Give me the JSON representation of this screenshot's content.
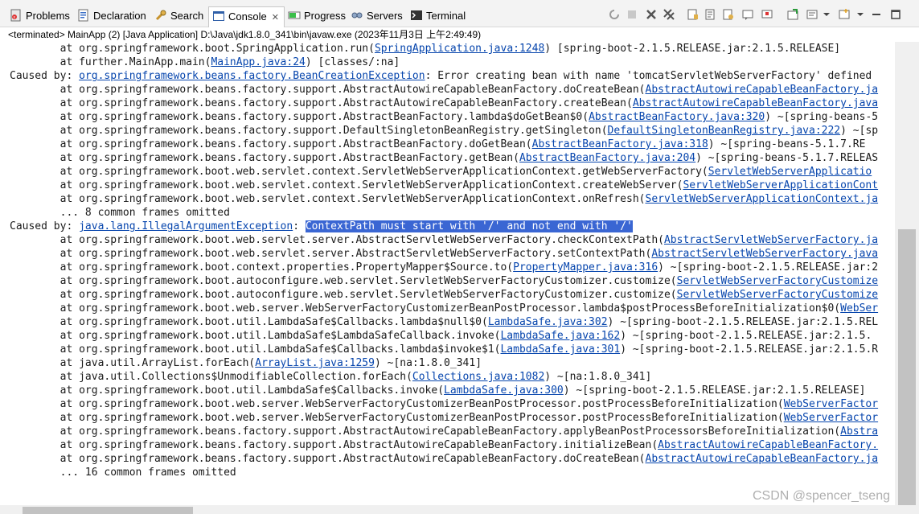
{
  "tabs": [
    {
      "label": "Problems",
      "icon": "problems-icon"
    },
    {
      "label": "Declaration",
      "icon": "declaration-icon"
    },
    {
      "label": "Search",
      "icon": "search-icon"
    },
    {
      "label": "Console",
      "icon": "console-icon",
      "active": true
    },
    {
      "label": "Progress",
      "icon": "progress-icon"
    },
    {
      "label": "Servers",
      "icon": "servers-icon"
    },
    {
      "label": "Terminal",
      "icon": "terminal-icon"
    }
  ],
  "status": "<terminated> MainApp (2) [Java Application] D:\\Java\\jdk1.8.0_341\\bin\\javaw.exe (2023年11月3日 上午2:49:49)",
  "console_lines": [
    [
      {
        "t": "        at org.springframework.boot.SpringApplication.run("
      },
      {
        "t": "SpringApplication.java:1248",
        "l": true
      },
      {
        "t": ") [spring-boot-2.1.5.RELEASE.jar:2.1.5.RELEASE]"
      }
    ],
    [
      {
        "t": "        at further.MainApp.main("
      },
      {
        "t": "MainApp.java:24",
        "l": true
      },
      {
        "t": ") [classes/:na]"
      }
    ],
    [
      {
        "t": "Caused by: "
      },
      {
        "t": "org.springframework.beans.factory.BeanCreationException",
        "l": true
      },
      {
        "t": ": Error creating bean with name 'tomcatServletWebServerFactory' defined"
      }
    ],
    [
      {
        "t": "        at org.springframework.beans.factory.support.AbstractAutowireCapableBeanFactory.doCreateBean("
      },
      {
        "t": "AbstractAutowireCapableBeanFactory.ja",
        "l": true
      }
    ],
    [
      {
        "t": "        at org.springframework.beans.factory.support.AbstractAutowireCapableBeanFactory.createBean("
      },
      {
        "t": "AbstractAutowireCapableBeanFactory.java",
        "l": true
      }
    ],
    [
      {
        "t": "        at org.springframework.beans.factory.support.AbstractBeanFactory.lambda$doGetBean$0("
      },
      {
        "t": "AbstractBeanFactory.java:320",
        "l": true
      },
      {
        "t": ") ~[spring-beans-5"
      }
    ],
    [
      {
        "t": "        at org.springframework.beans.factory.support.DefaultSingletonBeanRegistry.getSingleton("
      },
      {
        "t": "DefaultSingletonBeanRegistry.java:222",
        "l": true
      },
      {
        "t": ") ~[sp"
      }
    ],
    [
      {
        "t": "        at org.springframework.beans.factory.support.AbstractBeanFactory.doGetBean("
      },
      {
        "t": "AbstractBeanFactory.java:318",
        "l": true
      },
      {
        "t": ") ~[spring-beans-5.1.7.RE"
      }
    ],
    [
      {
        "t": "        at org.springframework.beans.factory.support.AbstractBeanFactory.getBean("
      },
      {
        "t": "AbstractBeanFactory.java:204",
        "l": true
      },
      {
        "t": ") ~[spring-beans-5.1.7.RELEAS"
      }
    ],
    [
      {
        "t": "        at org.springframework.boot.web.servlet.context.ServletWebServerApplicationContext.getWebServerFactory("
      },
      {
        "t": "ServletWebServerApplicatio",
        "l": true
      }
    ],
    [
      {
        "t": "        at org.springframework.boot.web.servlet.context.ServletWebServerApplicationContext.createWebServer("
      },
      {
        "t": "ServletWebServerApplicationCont",
        "l": true
      }
    ],
    [
      {
        "t": "        at org.springframework.boot.web.servlet.context.ServletWebServerApplicationContext.onRefresh("
      },
      {
        "t": "ServletWebServerApplicationContext.ja",
        "l": true
      }
    ],
    [
      {
        "t": "        ... 8 common frames omitted"
      }
    ],
    [
      {
        "t": "Caused by: "
      },
      {
        "t": "java.lang.IllegalArgumentException",
        "l": true
      },
      {
        "t": ": "
      },
      {
        "t": "ContextPath must start with '/' and not end with '/'",
        "h": true
      }
    ],
    [
      {
        "t": "        at org.springframework.boot.web.servlet.server.AbstractServletWebServerFactory.checkContextPath("
      },
      {
        "t": "AbstractServletWebServerFactory.ja",
        "l": true
      }
    ],
    [
      {
        "t": "        at org.springframework.boot.web.servlet.server.AbstractServletWebServerFactory.setContextPath("
      },
      {
        "t": "AbstractServletWebServerFactory.java",
        "l": true
      }
    ],
    [
      {
        "t": "        at org.springframework.boot.context.properties.PropertyMapper$Source.to("
      },
      {
        "t": "PropertyMapper.java:316",
        "l": true
      },
      {
        "t": ") ~[spring-boot-2.1.5.RELEASE.jar:2"
      }
    ],
    [
      {
        "t": "        at org.springframework.boot.autoconfigure.web.servlet.ServletWebServerFactoryCustomizer.customize("
      },
      {
        "t": "ServletWebServerFactoryCustomize",
        "l": true
      }
    ],
    [
      {
        "t": "        at org.springframework.boot.autoconfigure.web.servlet.ServletWebServerFactoryCustomizer.customize("
      },
      {
        "t": "ServletWebServerFactoryCustomize",
        "l": true
      }
    ],
    [
      {
        "t": "        at org.springframework.boot.web.server.WebServerFactoryCustomizerBeanPostProcessor.lambda$postProcessBeforeInitialization$0("
      },
      {
        "t": "WebSer",
        "l": true
      }
    ],
    [
      {
        "t": "        at org.springframework.boot.util.LambdaSafe$Callbacks.lambda$null$0("
      },
      {
        "t": "LambdaSafe.java:302",
        "l": true
      },
      {
        "t": ") ~[spring-boot-2.1.5.RELEASE.jar:2.1.5.REL"
      }
    ],
    [
      {
        "t": "        at org.springframework.boot.util.LambdaSafe$LambdaSafeCallback.invoke("
      },
      {
        "t": "LambdaSafe.java:162",
        "l": true
      },
      {
        "t": ") ~[spring-boot-2.1.5.RELEASE.jar:2.1.5."
      }
    ],
    [
      {
        "t": "        at org.springframework.boot.util.LambdaSafe$Callbacks.lambda$invoke$1("
      },
      {
        "t": "LambdaSafe.java:301",
        "l": true
      },
      {
        "t": ") ~[spring-boot-2.1.5.RELEASE.jar:2.1.5.R"
      }
    ],
    [
      {
        "t": "        at java.util.ArrayList.forEach("
      },
      {
        "t": "ArrayList.java:1259",
        "l": true
      },
      {
        "t": ") ~[na:1.8.0_341]"
      }
    ],
    [
      {
        "t": "        at java.util.Collections$UnmodifiableCollection.forEach("
      },
      {
        "t": "Collections.java:1082",
        "l": true
      },
      {
        "t": ") ~[na:1.8.0_341]"
      }
    ],
    [
      {
        "t": "        at org.springframework.boot.util.LambdaSafe$Callbacks.invoke("
      },
      {
        "t": "LambdaSafe.java:300",
        "l": true
      },
      {
        "t": ") ~[spring-boot-2.1.5.RELEASE.jar:2.1.5.RELEASE]"
      }
    ],
    [
      {
        "t": "        at org.springframework.boot.web.server.WebServerFactoryCustomizerBeanPostProcessor.postProcessBeforeInitialization("
      },
      {
        "t": "WebServerFactor",
        "l": true
      }
    ],
    [
      {
        "t": "        at org.springframework.boot.web.server.WebServerFactoryCustomizerBeanPostProcessor.postProcessBeforeInitialization("
      },
      {
        "t": "WebServerFactor",
        "l": true
      }
    ],
    [
      {
        "t": "        at org.springframework.beans.factory.support.AbstractAutowireCapableBeanFactory.applyBeanPostProcessorsBeforeInitialization("
      },
      {
        "t": "Abstra",
        "l": true
      }
    ],
    [
      {
        "t": "        at org.springframework.beans.factory.support.AbstractAutowireCapableBeanFactory.initializeBean("
      },
      {
        "t": "AbstractAutowireCapableBeanFactory.",
        "l": true
      }
    ],
    [
      {
        "t": "        at org.springframework.beans.factory.support.AbstractAutowireCapableBeanFactory.doCreateBean("
      },
      {
        "t": "AbstractAutowireCapableBeanFactory.ja",
        "l": true
      }
    ],
    [
      {
        "t": "        ... 16 common frames omitted"
      }
    ]
  ],
  "watermark": "CSDN @spencer_tseng",
  "colors": {
    "link": "#0645ad",
    "highlight_bg": "#3a66d3",
    "highlight_fg": "#ffffff"
  }
}
